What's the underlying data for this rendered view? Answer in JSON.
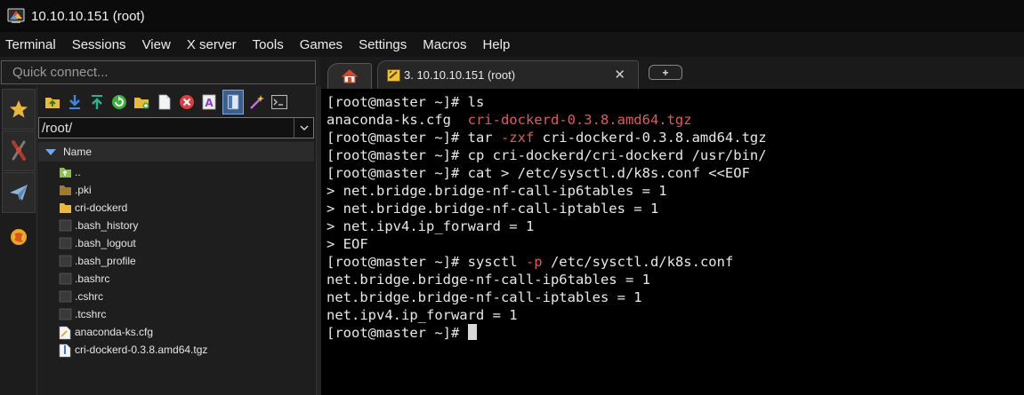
{
  "window": {
    "title": "10.10.10.151 (root)"
  },
  "menu": [
    "Terminal",
    "Sessions",
    "View",
    "X server",
    "Tools",
    "Games",
    "Settings",
    "Macros",
    "Help"
  ],
  "quick_connect": {
    "placeholder": "Quick connect..."
  },
  "tabs": {
    "session_label": "3. 10.10.10.151 (root)",
    "close_glyph": "✕",
    "add_glyph": "+"
  },
  "sidebar_icons": [
    "star-icon",
    "tools-icon",
    "send-icon",
    "macro-icon"
  ],
  "toolbar_icons": [
    "folder-up-icon",
    "download-icon",
    "upload-icon",
    "refresh-icon",
    "new-folder-icon",
    "new-file-icon",
    "delete-icon",
    "rename-icon",
    "toggle-terminal-folder-icon",
    "magic-wand-icon",
    "terminal-icon"
  ],
  "file_browser": {
    "path": "/root/",
    "column_name": "Name",
    "files": [
      {
        "name": "..",
        "icon": "parent-folder-icon"
      },
      {
        "name": ".pki",
        "icon": "folder-dim-icon"
      },
      {
        "name": "cri-dockerd",
        "icon": "folder-icon"
      },
      {
        "name": ".bash_history",
        "icon": "file-dark-icon"
      },
      {
        "name": ".bash_logout",
        "icon": "file-dark-icon"
      },
      {
        "name": ".bash_profile",
        "icon": "file-dark-icon"
      },
      {
        "name": ".bashrc",
        "icon": "file-dark-icon"
      },
      {
        "name": ".cshrc",
        "icon": "file-dark-icon"
      },
      {
        "name": ".tcshrc",
        "icon": "file-dark-icon"
      },
      {
        "name": "anaconda-ks.cfg",
        "icon": "text-file-icon"
      },
      {
        "name": "cri-dockerd-0.3.8.amd64.tgz",
        "icon": "archive-file-icon"
      }
    ]
  },
  "terminal": {
    "prompt": "[root@master ~]# ",
    "lines": [
      {
        "a": "[root@master ~]# ",
        "b": "ls",
        "c": "",
        "d": ""
      },
      {
        "a": "anaconda-ks.cfg  ",
        "b": "",
        "c": "cri-dockerd-0.3.8.amd64.tgz",
        "d": ""
      },
      {
        "a": "[root@master ~]# tar ",
        "b": "",
        "c": "-zxf",
        "d": " cri-dockerd-0.3.8.amd64.tgz"
      },
      {
        "a": "[root@master ~]# cp cri-dockerd/cri-dockerd /usr/bin/",
        "b": "",
        "c": "",
        "d": ""
      },
      {
        "a": "[root@master ~]# cat > /etc/sysctl.d/k8s.conf <<EOF",
        "b": "",
        "c": "",
        "d": ""
      },
      {
        "a": "> net.bridge.bridge-nf-call-ip6tables = 1",
        "b": "",
        "c": "",
        "d": ""
      },
      {
        "a": "> net.bridge.bridge-nf-call-iptables = 1",
        "b": "",
        "c": "",
        "d": ""
      },
      {
        "a": "> net.ipv4.ip_forward = 1",
        "b": "",
        "c": "",
        "d": ""
      },
      {
        "a": "> EOF",
        "b": "",
        "c": "",
        "d": ""
      },
      {
        "a": "[root@master ~]# sysctl ",
        "b": "",
        "c": "-p",
        "d": " /etc/sysctl.d/k8s.conf"
      },
      {
        "a": "net.bridge.bridge-nf-call-ip6tables = 1",
        "b": "",
        "c": "",
        "d": ""
      },
      {
        "a": "net.bridge.bridge-nf-call-iptables = 1",
        "b": "",
        "c": "",
        "d": ""
      },
      {
        "a": "net.ipv4.ip_forward = 1",
        "b": "",
        "c": "",
        "d": ""
      }
    ],
    "last_prompt": "[root@master ~]# "
  },
  "colors": {
    "accent_red": "#e05a5a",
    "folder_yellow": "#f2b630",
    "header_blue": "#6ea7e8"
  }
}
